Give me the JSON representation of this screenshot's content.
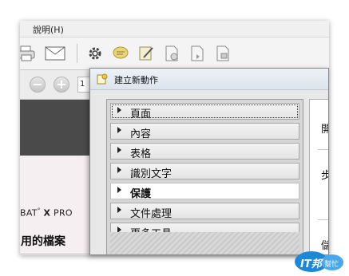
{
  "menubar": {
    "help_label": "說明(H)"
  },
  "toolbar": {
    "icons": [
      "print-icon",
      "mail-icon",
      "gear-icon",
      "comment-icon",
      "edit-icon",
      "pdf-icon",
      "pdf-icon",
      "pdf-icon"
    ]
  },
  "nav": {
    "page_value": "1"
  },
  "document": {
    "brand_prefix": "BAT",
    "brand_mark": "°",
    "brand_x": "X",
    "brand_suffix": "PRO",
    "heading": "用的檔案"
  },
  "dialog": {
    "title": "建立新動作",
    "categories": [
      {
        "label": "頁面"
      },
      {
        "label": "內容"
      },
      {
        "label": "表格"
      },
      {
        "label": "識別文字"
      },
      {
        "label": "保護"
      },
      {
        "label": "文件處理"
      },
      {
        "label": "更多工具"
      }
    ],
    "right_glyphs": [
      "開",
      "步",
      "儲"
    ]
  },
  "watermark": {
    "text": "IT邦",
    "sub": "幫忙"
  },
  "colors": {
    "dark_band": "#4a4a4a",
    "doc_tint": "#f6eff1",
    "watermark": "#1e88d8"
  }
}
